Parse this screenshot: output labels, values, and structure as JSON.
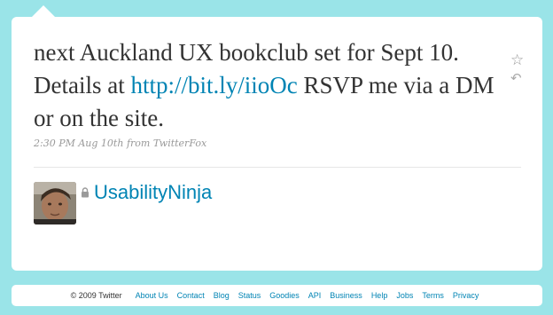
{
  "tweet": {
    "text_before": "next Auckland UX bookclub set for Sept 10. Details at ",
    "link": "http://bit.ly/iioOc",
    "text_after": " RSVP me via a DM or on the site.",
    "time": "2:30 PM Aug 10th",
    "source_prefix": "from",
    "source": "TwitterFox"
  },
  "user": {
    "name": "UsabilityNinja"
  },
  "icons": {
    "favorite": "star-icon",
    "reply": "reply-icon",
    "protected": "lock-icon"
  },
  "footer": {
    "copyright": "© 2009 Twitter",
    "links": [
      "About Us",
      "Contact",
      "Blog",
      "Status",
      "Goodies",
      "API",
      "Business",
      "Help",
      "Jobs",
      "Terms",
      "Privacy"
    ]
  },
  "colors": {
    "background": "#9ae4e8",
    "link": "#0084b4",
    "text": "#333333"
  }
}
